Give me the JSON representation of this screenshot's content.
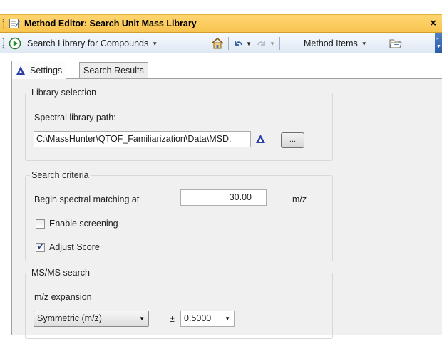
{
  "window": {
    "title": "Method Editor: Search Unit Mass Library",
    "close_glyph": "×"
  },
  "toolbar": {
    "run_label": "Search Library for Compounds",
    "method_items_label": "Method Items"
  },
  "tabs": [
    {
      "label": "Settings",
      "active": true
    },
    {
      "label": "Search Results",
      "active": false
    }
  ],
  "library_selection": {
    "legend": "Library selection",
    "path_label": "Spectral library path:",
    "path_value": "C:\\MassHunter\\QTOF_Familiarization\\Data\\MSD.",
    "browse_label": "..."
  },
  "search_criteria": {
    "legend": "Search criteria",
    "begin_label": "Begin spectral matching at",
    "begin_value": "30.00",
    "begin_unit": "m/z",
    "enable_screening_label": "Enable screening",
    "enable_screening_checked": false,
    "adjust_score_label": "Adjust Score",
    "adjust_score_checked": true
  },
  "msms_search": {
    "legend": "MS/MS search",
    "expansion_label": "m/z expansion",
    "expansion_mode": "Symmetric (m/z)",
    "plus_minus": "±",
    "expansion_value": "0.5000"
  },
  "colors": {
    "title_bar": "#f8c450",
    "accent_blue": "#2b5ba3"
  }
}
